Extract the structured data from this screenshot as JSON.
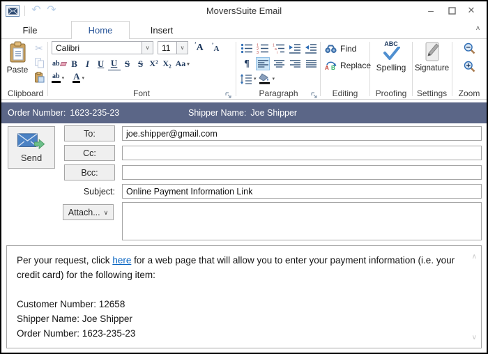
{
  "titlebar": {
    "title": "MoversSuite Email"
  },
  "tabs": {
    "file": "File",
    "home": "Home",
    "insert": "Insert"
  },
  "ribbon": {
    "clipboard": {
      "group_label": "Clipboard",
      "paste_label": "Paste"
    },
    "font": {
      "group_label": "Font",
      "font_name": "Calibri",
      "font_size": "11",
      "grow_font": "A",
      "shrink_font": "A",
      "clear_format": "ab",
      "bold": "B",
      "italic": "I",
      "underline": "U",
      "double_underline": "U",
      "strikethrough": "S",
      "double_strikethrough": "S",
      "superscript": "X²",
      "subscript": "X₂",
      "change_case": "Aa",
      "highlight": "ab",
      "font_color": "A"
    },
    "paragraph": {
      "group_label": "Paragraph",
      "pilcrow": "¶"
    },
    "editing": {
      "group_label": "Editing",
      "find_label": "Find",
      "replace_label": "Replace"
    },
    "proofing": {
      "group_label": "Proofing",
      "spelling_label": "Spelling",
      "spelling_abc": "ABC"
    },
    "settings": {
      "group_label": "Settings",
      "signature_label": "Signature"
    },
    "zoom": {
      "group_label": "Zoom"
    }
  },
  "order_bar": {
    "order_label": "Order Number:",
    "order_value": "1623-235-23",
    "shipper_label": "Shipper Name:",
    "shipper_value": "Joe Shipper"
  },
  "compose": {
    "send_label": "Send",
    "to_label": "To:",
    "to_value": "joe.shipper@gmail.com",
    "cc_label": "Cc:",
    "cc_value": "",
    "bcc_label": "Bcc:",
    "bcc_value": "",
    "subject_label": "Subject:",
    "subject_value": "Online Payment Information Link",
    "attach_label": "Attach..."
  },
  "body": {
    "para_before_link": "Per your request, click ",
    "link_text": "here",
    "para_after_link": " for a web page that will allow you to enter your payment information (i.e. your credit card) for the following item:",
    "customer_line": "Customer Number: 12658",
    "shipper_line": "Shipper Name: Joe Shipper",
    "order_line": "Order Number: 1623-235-23"
  },
  "icons": {
    "undo": "↶",
    "redo": "↷",
    "minimize": "–",
    "close": "✕",
    "ribbon_collapse": "ʌ",
    "scissors": "✂",
    "combo_chevron": "∨",
    "dropdown_arrow": "▾",
    "tick_up": "ʼ",
    "attach_chevron": "∨",
    "scroll_up": "∧",
    "scroll_down": "∨"
  },
  "colors": {
    "order_bar_bg": "#5b6687",
    "active_tab_text": "#2b579a",
    "ribbon_icon_navy": "#1f3a5f",
    "selected_button_bg": "#cde6f7",
    "link_color": "#0563c1"
  }
}
